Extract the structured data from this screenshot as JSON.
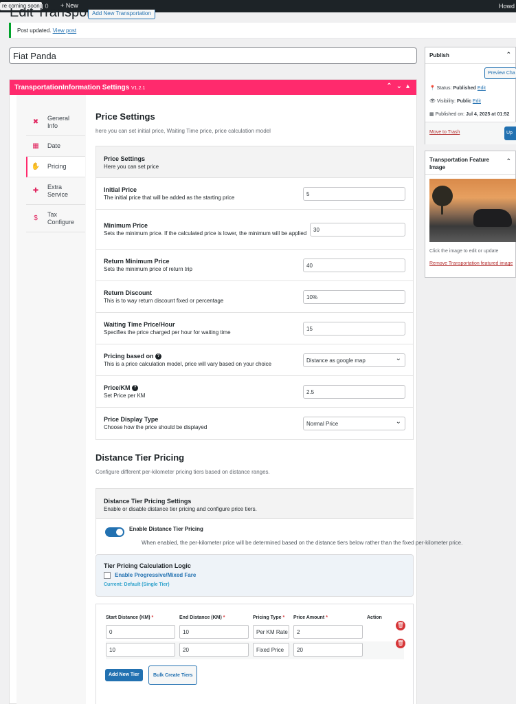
{
  "adminbar": {
    "site_badge": "re coming soon",
    "comments_count": "0",
    "new_label": "+ New",
    "howdy": "Howd"
  },
  "page": {
    "heading": "Edit Transportation",
    "add_new": "Add New Transportation",
    "notice_text": "Post updated.",
    "notice_link": "View post",
    "post_title": "Fiat Panda"
  },
  "metabox": {
    "title": "TransportationInformation Settings",
    "version": "V1.2.1"
  },
  "tabs": [
    {
      "label": "General Info",
      "icon": "tools-icon"
    },
    {
      "label": "Date",
      "icon": "calendar-icon"
    },
    {
      "label": "Pricing",
      "icon": "hand-money-icon"
    },
    {
      "label": "Extra Service",
      "icon": "puzzle-icon"
    },
    {
      "label": "Tax Configure",
      "icon": "hand-dollar-icon"
    }
  ],
  "price_settings": {
    "title": "Price Settings",
    "subtitle": "here you can set initial price, Waiting Time price, price calculation model",
    "card_title": "Price Settings",
    "card_sub": "Here you can set price",
    "rows": [
      {
        "label": "Initial Price",
        "desc": "The initial price that will be added as the starting price",
        "value": "5"
      },
      {
        "label": "Minimum Price",
        "desc": "Sets the minimum price. If the calculated price is lower, the minimum will be applied",
        "value": "30"
      },
      {
        "label": "Return Minimum Price",
        "desc": "Sets the minimum price of return trip",
        "value": "40"
      },
      {
        "label": "Return Discount",
        "desc": "This is to way return discount fixed or percentage",
        "value": "10%"
      },
      {
        "label": "Waiting Time Price/Hour",
        "desc": "Specifies the price charged per hour for waiting time",
        "value": "15"
      },
      {
        "label": "Pricing based on",
        "desc": "This is a price calculation model, price will vary based on your choice",
        "value": "Distance as google map"
      },
      {
        "label": "Price/KM",
        "desc": "Set Price per KM",
        "value": "2.5"
      },
      {
        "label": "Price Display Type",
        "desc": "Choose how the price should be displayed",
        "value": "Normal Price"
      }
    ]
  },
  "tier_pricing": {
    "title": "Distance Tier Pricing",
    "subtitle": "Configure different per-kilometer pricing tiers based on distance ranges.",
    "card_title": "Distance Tier Pricing Settings",
    "card_sub": "Enable or disable distance tier pricing and configure price tiers.",
    "toggle_label": "Enable Distance Tier Pricing",
    "toggle_desc": "When enabled, the per-kilometer price will be determined based on the distance tiers below rather than the fixed per-kilometer price.",
    "logic_title": "Tier Pricing Calculation Logic",
    "logic_checkbox": "Enable Progressive/Mixed Fare",
    "logic_current": "Current: Default (Single Tier)",
    "columns": [
      "Start Distance (KM)",
      "End Distance (KM)",
      "Pricing Type",
      "Price Amount",
      "Action"
    ],
    "rows": [
      {
        "start": "0",
        "end": "10",
        "type": "Per KM Rate",
        "amount": "2"
      },
      {
        "start": "10",
        "end": "20",
        "type": "Fixed Price",
        "amount": "20"
      }
    ],
    "add_button": "Add New Tier",
    "bulk_button": "Bulk Create Tiers"
  },
  "publish": {
    "title": "Publish",
    "preview": "Preview Cha",
    "status_label": "Status:",
    "status_value": "Published",
    "status_edit": "Edit",
    "visibility_label": "Visibility:",
    "visibility_value": "Public",
    "visibility_edit": "Edit",
    "published_label": "Published on:",
    "published_value": "Jul 4, 2025 at 01:52",
    "trash": "Move to Trash",
    "update": "Up"
  },
  "featured": {
    "title": "Transportation Feature Image",
    "hint": "Click the image to edit or update",
    "remove": "Remove Transportation featured image"
  },
  "colors": {
    "accent": "#ff2a6d",
    "link": "#2271b1",
    "danger": "#d63638"
  }
}
